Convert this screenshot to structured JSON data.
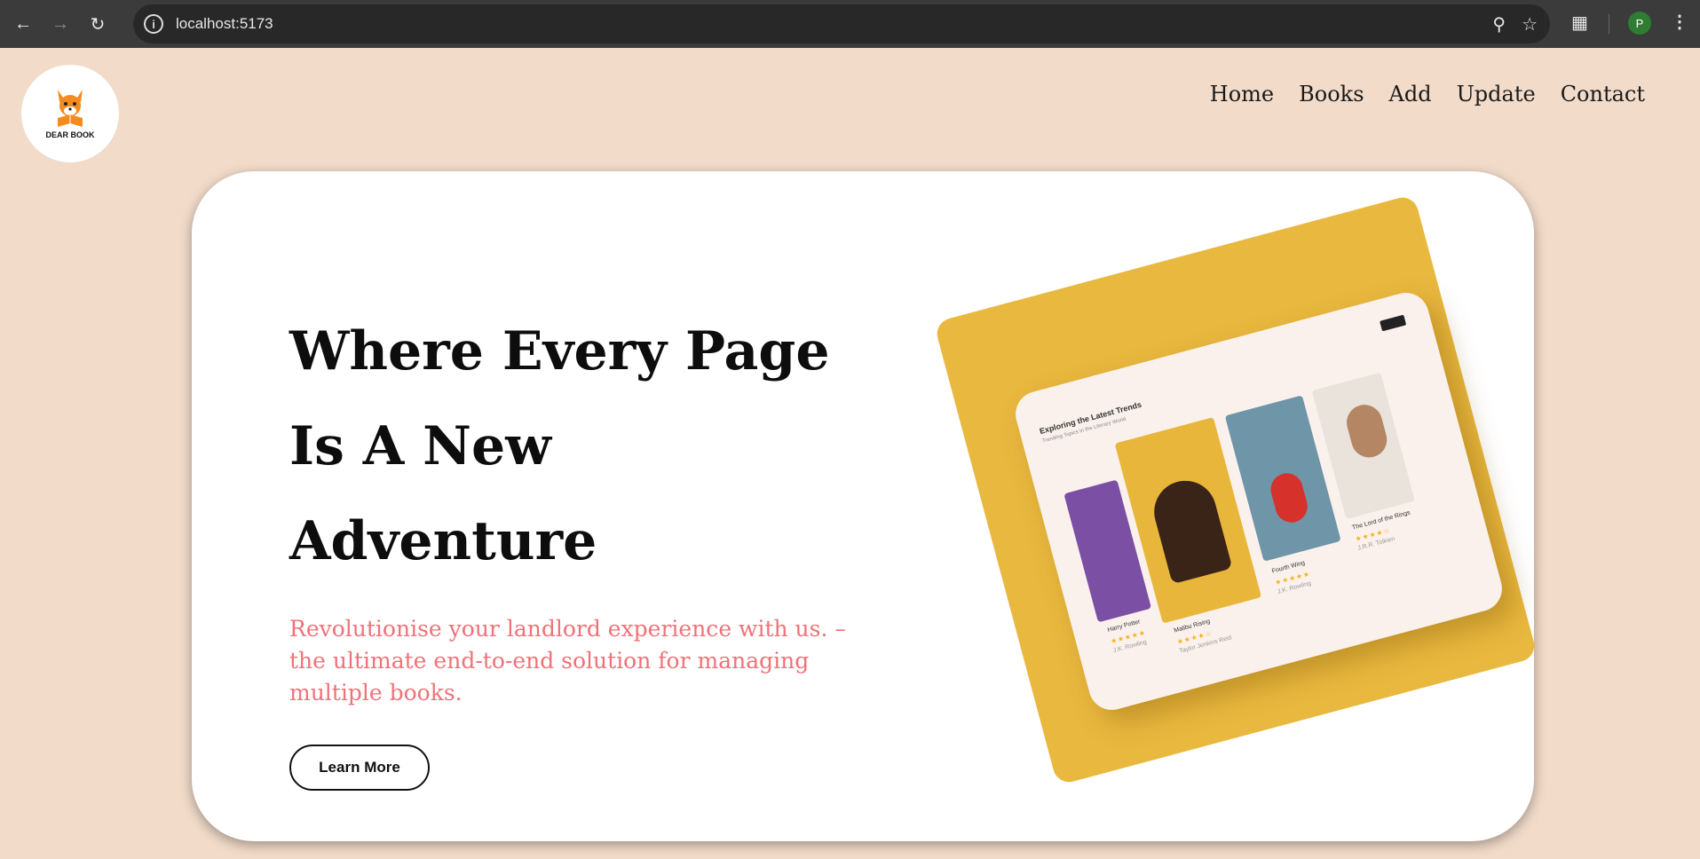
{
  "browser": {
    "url": "localhost:5173",
    "profile_initial": "P"
  },
  "site": {
    "logo_text": "DEAR BOOK",
    "nav": [
      "Home",
      "Books",
      "Add",
      "Update",
      "Contact"
    ]
  },
  "hero": {
    "title_lines": [
      "Where Every Page",
      "Is A New",
      "Adventure"
    ],
    "subtitle": "Revolutionise your landlord experience with us. – the ultimate end-to-end solution for managing multiple books.",
    "cta_label": "Learn More"
  },
  "illustration": {
    "heading": "Exploring the Latest Trends",
    "subheading": "Trending Topics in the Literary World",
    "books": [
      {
        "title": "Harry Potter",
        "author": "J.K. Rowling",
        "rating": "5"
      },
      {
        "title": "Malibu Rising",
        "author": "Taylor Jenkins Reid",
        "rating": "4"
      },
      {
        "title": "Fourth Wing",
        "author": "J.K. Rowling",
        "rating": "5"
      },
      {
        "title": "The Lord of the Rings",
        "author": "J.R.R. Tolkien",
        "rating": "4.8"
      }
    ]
  },
  "colors": {
    "page_bg": "#f2dbc9",
    "accent_text": "#f17178",
    "illustration_yellow": "#e9b83e"
  }
}
